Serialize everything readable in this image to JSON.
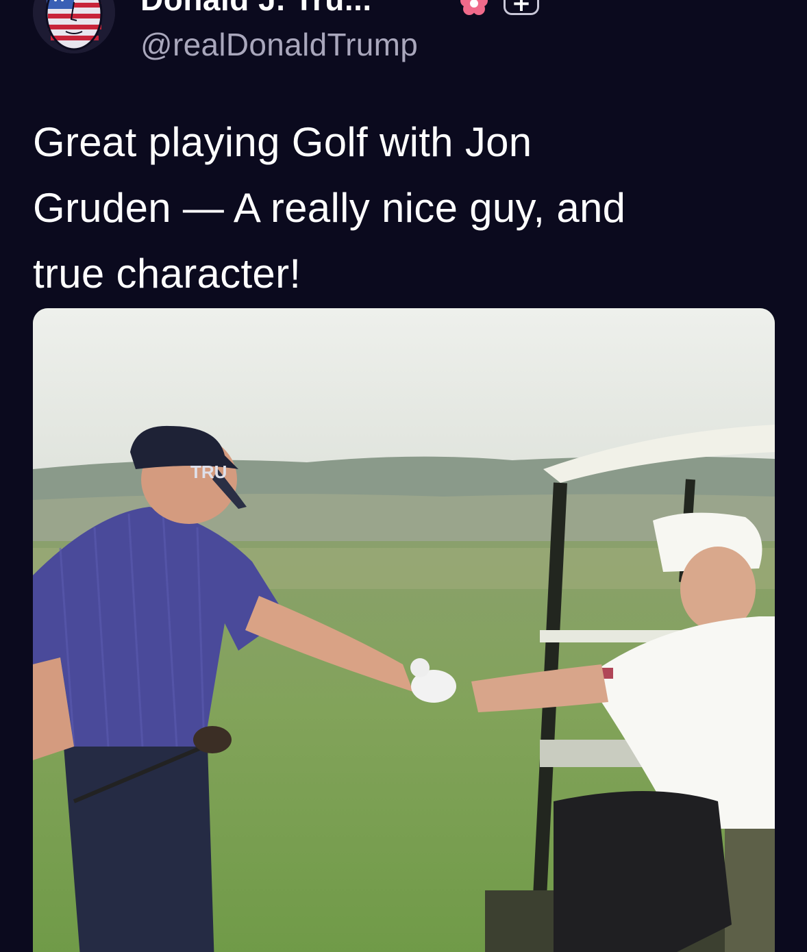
{
  "post": {
    "author": {
      "display_name": "Donald J. Tru...",
      "handle": "@realDonaldTrump",
      "avatar_icon": "flag-face-avatar-icon",
      "badge_icon": "flower-badge-icon",
      "follow_icon": "plus-icon",
      "follow_symbol": "+"
    },
    "text": "Great playing Golf with Jon\nGruden — A really nice guy, and\ntrue character!",
    "media": {
      "type": "photo",
      "cap_text": "TRU"
    }
  },
  "colors": {
    "background": "#0b0a1e",
    "text_primary": "#ffffff",
    "text_secondary": "#a9a7bc",
    "badge_pink": "#f06a8a"
  }
}
